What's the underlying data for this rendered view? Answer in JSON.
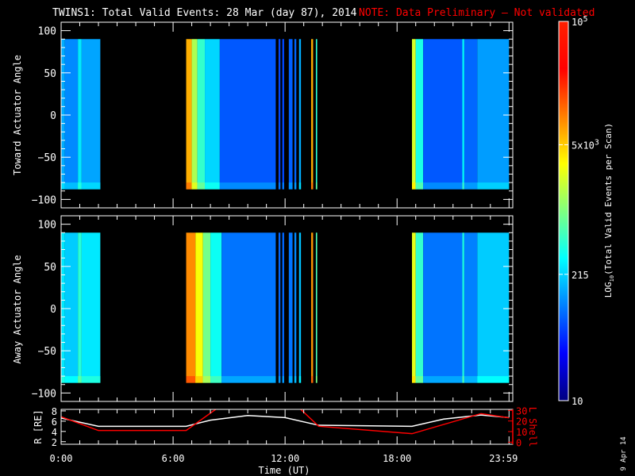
{
  "title": {
    "main": "TWINS1: Total Valid Events: 28 Mar (day  87), 2014",
    "note": "NOTE: Data Preliminary — Not validated",
    "note_color": "#ff0000"
  },
  "side_date": "9 Apr 14",
  "chart_data": [
    {
      "type": "heatmap",
      "panel": "toward",
      "ylabel": "Toward Actuator Angle",
      "ylim": [
        -110,
        110
      ],
      "yticks": [
        -100,
        -50,
        0,
        50,
        100
      ],
      "xlim": [
        0,
        24
      ],
      "angle_range": [
        -88,
        90
      ],
      "segments": [
        [
          0,
          0.2,
          150
        ],
        [
          0.2,
          0.9,
          110
        ],
        [
          0.9,
          1.1,
          260
        ],
        [
          1.1,
          2.1,
          140
        ],
        [
          6.7,
          7.0,
          6500
        ],
        [
          7.0,
          7.3,
          1500
        ],
        [
          7.3,
          7.7,
          500
        ],
        [
          7.7,
          8.5,
          220
        ],
        [
          8.5,
          11.5,
          70
        ],
        [
          11.65,
          11.75,
          60
        ],
        [
          11.85,
          11.95,
          60
        ],
        [
          12.2,
          12.4,
          75
        ],
        [
          12.5,
          12.6,
          80
        ],
        [
          12.75,
          12.85,
          150
        ],
        [
          13.4,
          13.5,
          6500
        ],
        [
          13.65,
          13.72,
          450
        ],
        [
          18.8,
          19.0,
          2200
        ],
        [
          19.0,
          19.4,
          400
        ],
        [
          19.4,
          21.5,
          70
        ],
        [
          21.5,
          21.6,
          320
        ],
        [
          21.6,
          22.3,
          80
        ],
        [
          22.3,
          24,
          130
        ]
      ]
    },
    {
      "type": "heatmap",
      "panel": "away",
      "ylabel": "Away Actuator Angle",
      "ylim": [
        -110,
        110
      ],
      "yticks": [
        -100,
        -50,
        0,
        50,
        100
      ],
      "xlim": [
        0,
        24
      ],
      "angle_range": [
        -88,
        90
      ],
      "segments": [
        [
          0,
          0.2,
          260
        ],
        [
          0.2,
          0.9,
          200
        ],
        [
          0.9,
          1.1,
          450
        ],
        [
          1.1,
          2.1,
          260
        ],
        [
          6.7,
          7.2,
          9000
        ],
        [
          7.2,
          7.6,
          3000
        ],
        [
          7.6,
          8.0,
          900
        ],
        [
          8.0,
          8.6,
          350
        ],
        [
          8.6,
          11.5,
          90
        ],
        [
          11.65,
          11.75,
          80
        ],
        [
          11.85,
          11.95,
          80
        ],
        [
          12.2,
          12.4,
          90
        ],
        [
          12.5,
          12.6,
          110
        ],
        [
          12.75,
          12.85,
          180
        ],
        [
          13.4,
          13.5,
          8000
        ],
        [
          13.65,
          13.72,
          600
        ],
        [
          18.8,
          19.0,
          2500
        ],
        [
          19.0,
          19.4,
          500
        ],
        [
          19.4,
          21.5,
          90
        ],
        [
          21.5,
          21.6,
          400
        ],
        [
          21.6,
          22.3,
          100
        ],
        [
          22.3,
          24,
          200
        ]
      ]
    },
    {
      "type": "line",
      "panel": "orbit",
      "xlabel": "Time (UT)",
      "xticks": [
        "0:00",
        "6:00",
        "12:00",
        "18:00",
        "23:59"
      ],
      "xlim": [
        0,
        24
      ],
      "ylabel_left": "R [RE]",
      "ylim_left": [
        1.5,
        8.3
      ],
      "yticks_left": [
        2,
        4,
        6,
        8
      ],
      "ylabel_right": "L Shell",
      "ylim_right": [
        -2,
        31
      ],
      "yticks_right": [
        0,
        10,
        20,
        30
      ],
      "series": [
        {
          "name": "R",
          "color": "#ffffff",
          "x": [
            0,
            2,
            6.7,
            8,
            10,
            12,
            13.8,
            18.8,
            20.5,
            22.5,
            24
          ],
          "y": [
            6.6,
            5,
            5,
            6.2,
            7.1,
            6.7,
            5.2,
            5,
            6.4,
            7.2,
            6.7
          ]
        },
        {
          "name": "L Shell",
          "color": "#ff0000",
          "x": [
            0,
            2,
            6.7,
            8.6,
            12.6,
            13.8,
            18.8,
            22.5,
            24
          ],
          "y": [
            24,
            11,
            11,
            35,
            35,
            15,
            8,
            27,
            23
          ]
        }
      ]
    }
  ],
  "colorbar": {
    "label": "LOG10(Total Valid Events per Scan)",
    "label_prefix": "LOG",
    "label_sub": "10",
    "label_rest": "(Total Valid Events per Scan)",
    "range": [
      10,
      100000
    ],
    "ticks": [
      {
        "value": 10,
        "label": "10"
      },
      {
        "value": 215,
        "label": "215"
      },
      {
        "value": 5000,
        "label": "5x10",
        "sup": "3"
      },
      {
        "value": 100000,
        "label": "10",
        "sup": "5"
      }
    ]
  }
}
